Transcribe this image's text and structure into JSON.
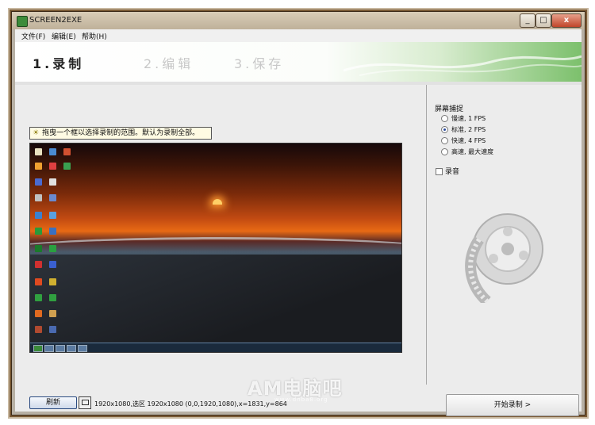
{
  "window": {
    "title": "SCREEN2EXE",
    "buttons": {
      "minimize": "_",
      "maximize": "□",
      "close": "x"
    }
  },
  "menu": [
    "文件(F)",
    "编辑(E)",
    "帮助(H)"
  ],
  "steps": [
    {
      "label": "1.录制",
      "active": true
    },
    {
      "label": "2.编辑",
      "active": false
    },
    {
      "label": "3.保存",
      "active": false
    }
  ],
  "left": {
    "hint": "拖曳一个框以选择录制的范围。默认为录制全部。",
    "refresh_label": "刷新",
    "status": "1920x1080,选区  1920x1080 (0,0,1920,1080),x=1831,y=864"
  },
  "right": {
    "group_title": "屏幕捕捉",
    "options": [
      {
        "label": "慢速, 1 FPS",
        "selected": false
      },
      {
        "label": "标准, 2 FPS",
        "selected": true
      },
      {
        "label": "快速, 4 FPS",
        "selected": false
      },
      {
        "label": "高速, 最大速度",
        "selected": false
      }
    ],
    "audio_label": "录音",
    "audio_checked": false,
    "start_label": "开始录制 >"
  },
  "watermark": {
    "text": "AM电脑吧",
    "sub": "www.dnba8.org"
  },
  "colors": {
    "accent_green": "#7cc06c",
    "close_red": "#c0452a"
  }
}
